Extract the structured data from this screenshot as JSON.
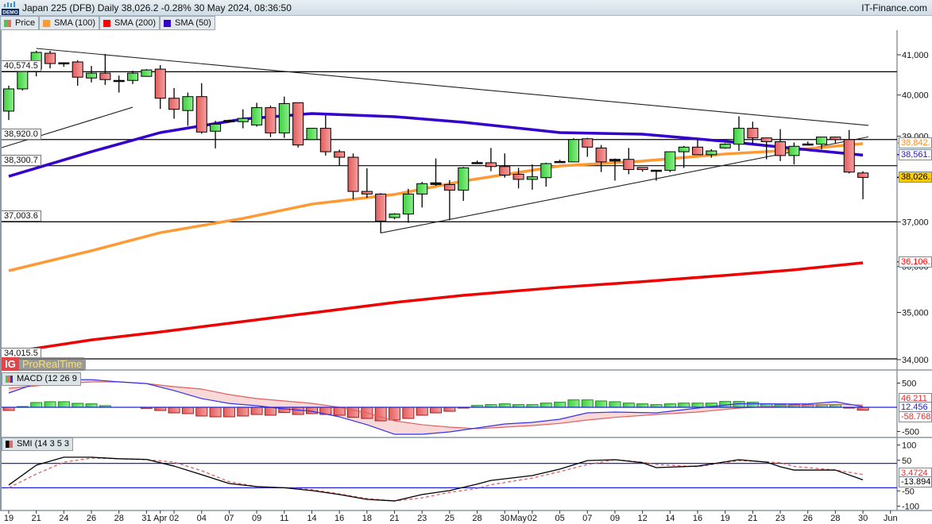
{
  "header": {
    "title": "Japan 225 (DFB) Daily 38,026.2 -0.28% 30 May 2024, 08:36:50",
    "brand": "IT-Finance.com",
    "demo_badge": "DEMO"
  },
  "legend": [
    {
      "label": "Price",
      "colors": [
        "#44cc44",
        "#e86a6a"
      ]
    },
    {
      "label": "SMA (100)",
      "color": "#ff9933"
    },
    {
      "label": "SMA (200)",
      "color": "#ff0000"
    },
    {
      "label": "SMA (50)",
      "color": "#3300cc"
    }
  ],
  "logo": {
    "ig": "IG",
    "text": "ProRealTime"
  },
  "chart_data": {
    "type": "candlestick",
    "title": "Japan 225 (DFB) Daily",
    "price_scale": "log",
    "ylim": [
      34000,
      41500
    ],
    "y_ticks": [
      "41,000",
      "40,000",
      "39,000",
      "37,000",
      "36,000",
      "35,000",
      "34,000"
    ],
    "y_tick_values": [
      41000,
      40000,
      39000,
      37000,
      36000,
      35000,
      34000
    ],
    "x_ticks": [
      {
        "label": "19",
        "i": 0
      },
      {
        "label": "21",
        "i": 2
      },
      {
        "label": "24",
        "i": 4
      },
      {
        "label": "26",
        "i": 6
      },
      {
        "label": "28",
        "i": 8
      },
      {
        "label": "31",
        "i": 10
      },
      {
        "label": "Apr",
        "i": 11
      },
      {
        "label": "02",
        "i": 12
      },
      {
        "label": "04",
        "i": 14
      },
      {
        "label": "07",
        "i": 16
      },
      {
        "label": "09",
        "i": 18
      },
      {
        "label": "11",
        "i": 20
      },
      {
        "label": "14",
        "i": 22
      },
      {
        "label": "16",
        "i": 24
      },
      {
        "label": "18",
        "i": 26
      },
      {
        "label": "21",
        "i": 28
      },
      {
        "label": "23",
        "i": 30
      },
      {
        "label": "25",
        "i": 32
      },
      {
        "label": "28",
        "i": 34
      },
      {
        "label": "30",
        "i": 36
      },
      {
        "label": "May",
        "i": 37
      },
      {
        "label": "02",
        "i": 38
      },
      {
        "label": "05",
        "i": 40
      },
      {
        "label": "07",
        "i": 42
      },
      {
        "label": "09",
        "i": 44
      },
      {
        "label": "12",
        "i": 46
      },
      {
        "label": "14",
        "i": 48
      },
      {
        "label": "16",
        "i": 50
      },
      {
        "label": "19",
        "i": 52
      },
      {
        "label": "21",
        "i": 54
      },
      {
        "label": "23",
        "i": 56
      },
      {
        "label": "26",
        "i": 58
      },
      {
        "label": "28",
        "i": 60
      },
      {
        "label": "30",
        "i": 62
      },
      {
        "label": "Jun",
        "i": 64
      }
    ],
    "candles": [
      [
        39606,
        40230,
        39390,
        40150
      ],
      [
        40150,
        40580,
        40110,
        40580
      ],
      [
        40640,
        41100,
        40460,
        41060
      ],
      [
        41040,
        41100,
        40660,
        40780
      ],
      [
        40800,
        40810,
        40700,
        40790
      ],
      [
        40820,
        40860,
        40230,
        40440
      ],
      [
        40420,
        40720,
        40310,
        40540
      ],
      [
        40540,
        41020,
        40250,
        40380
      ],
      [
        40360,
        40480,
        40060,
        40340
      ],
      [
        40360,
        40600,
        40270,
        40540
      ],
      [
        40460,
        40640,
        40460,
        40620
      ],
      [
        40640,
        40740,
        39660,
        39920
      ],
      [
        39920,
        40170,
        39420,
        39650
      ],
      [
        39620,
        40060,
        39250,
        39960
      ],
      [
        39960,
        40290,
        39060,
        39100
      ],
      [
        39120,
        39370,
        38710,
        39290
      ],
      [
        39350,
        39400,
        39330,
        39380
      ],
      [
        39350,
        39650,
        39190,
        39430
      ],
      [
        39270,
        39810,
        39230,
        39690
      ],
      [
        39690,
        39740,
        38980,
        39080
      ],
      [
        39080,
        39960,
        38960,
        39790
      ],
      [
        39810,
        39810,
        38730,
        38790
      ],
      [
        38920,
        39190,
        38920,
        39190
      ],
      [
        39190,
        39500,
        38540,
        38630
      ],
      [
        38630,
        38680,
        38300,
        38500
      ],
      [
        38500,
        38590,
        37520,
        37700
      ],
      [
        37700,
        38240,
        37550,
        37640
      ],
      [
        37640,
        37660,
        36750,
        37020
      ],
      [
        37100,
        37200,
        37060,
        37180
      ],
      [
        37180,
        37760,
        36980,
        37640
      ],
      [
        37640,
        37920,
        37330,
        37880
      ],
      [
        37900,
        38470,
        37830,
        37860
      ],
      [
        37860,
        37960,
        37040,
        37730
      ],
      [
        37730,
        38270,
        37480,
        38250
      ],
      [
        38370,
        38420,
        38350,
        38375
      ],
      [
        38370,
        38720,
        38170,
        38280
      ],
      [
        38280,
        38590,
        38020,
        38080
      ],
      [
        38100,
        38250,
        37770,
        37980
      ],
      [
        37980,
        38330,
        37740,
        38040
      ],
      [
        38020,
        38370,
        37810,
        38350
      ],
      [
        38390,
        38440,
        38370,
        38400
      ],
      [
        38390,
        38950,
        38390,
        38920
      ],
      [
        38940,
        38960,
        38510,
        38740
      ],
      [
        38720,
        38790,
        38150,
        38390
      ],
      [
        38410,
        38470,
        37950,
        38450
      ],
      [
        38450,
        38720,
        38100,
        38210
      ],
      [
        38260,
        38260,
        38160,
        38210
      ],
      [
        38190,
        38200,
        37950,
        38195
      ],
      [
        38190,
        38630,
        38150,
        38630
      ],
      [
        38630,
        38770,
        38250,
        38740
      ],
      [
        38740,
        38920,
        38560,
        38560
      ],
      [
        38560,
        38690,
        38490,
        38650
      ],
      [
        38720,
        38830,
        38700,
        38810
      ],
      [
        38810,
        39480,
        38650,
        39190
      ],
      [
        39190,
        39350,
        38790,
        38960
      ],
      [
        38960,
        38960,
        38450,
        38870
      ],
      [
        38870,
        39170,
        38410,
        38540
      ],
      [
        38540,
        38850,
        38330,
        38760
      ],
      [
        38810,
        38870,
        38790,
        38815
      ],
      [
        38810,
        38980,
        38690,
        38980
      ],
      [
        38980,
        38990,
        38830,
        38920
      ],
      [
        38920,
        39150,
        38120,
        38150
      ],
      [
        38130,
        38170,
        37520,
        38026
      ]
    ],
    "sma_index": [
      0,
      6,
      11,
      17,
      22,
      28,
      33,
      40,
      46,
      52,
      57,
      62
    ],
    "sma50": [
      38052,
      38631,
      39087,
      39413,
      39547,
      39470,
      39336,
      39087,
      39049,
      38878,
      38708,
      38551
    ],
    "sma100": [
      35908,
      36352,
      36757,
      37081,
      37408,
      37630,
      37941,
      38294,
      38409,
      38577,
      38671,
      38823
    ],
    "sma200": [
      34150,
      34415,
      34583,
      34805,
      34990,
      35215,
      35370,
      35543,
      35667,
      35806,
      35928,
      36083
    ],
    "trendlines": [
      {
        "from": [
          2,
          41160
        ],
        "to": [
          62.4,
          39260
        ]
      },
      {
        "from": [
          -0.6,
          38720
        ],
        "to": [
          9,
          39700
        ]
      },
      {
        "from": [
          27,
          36750
        ],
        "to": [
          62.4,
          38985
        ]
      }
    ],
    "levels": [
      {
        "value": 40574.5,
        "label": "40,574.5"
      },
      {
        "value": 38920.0,
        "label": "38,920.0"
      },
      {
        "value": 38300.7,
        "label": "38,300.7"
      },
      {
        "value": 37003.6,
        "label": "37,003.6"
      },
      {
        "value": 34015.5,
        "label": "34,015.5"
      }
    ],
    "last_values": [
      {
        "label": "38,842..",
        "value": 38842,
        "color": "#ff8c1a",
        "bg": "#ffffff"
      },
      {
        "label": "38,561..",
        "value": 38561,
        "color": "#2a12d0",
        "bg": "#ffffff"
      },
      {
        "label": "38,026..",
        "value": 38026,
        "color": "#000000",
        "bg": "#ffcc00"
      },
      {
        "label": "36,106..",
        "value": 36106,
        "color": "#ff0000",
        "bg": "#ffffff"
      }
    ],
    "macd": {
      "label": "MACD (12 26 9",
      "ticks": [
        {
          "label": "500",
          "v": 500
        },
        {
          "label": "-500",
          "v": -500
        }
      ],
      "hist": [
        -65,
        16,
        98,
        115,
        115,
        82,
        71,
        33,
        0,
        0,
        -22,
        -66,
        -115,
        -131,
        -180,
        -197,
        -197,
        -180,
        -148,
        -164,
        -109,
        -148,
        -131,
        -148,
        -164,
        -208,
        -230,
        -279,
        -262,
        -230,
        -164,
        -115,
        -82,
        -16,
        38,
        55,
        71,
        55,
        55,
        87,
        104,
        153,
        153,
        131,
        115,
        87,
        71,
        55,
        71,
        87,
        87,
        87,
        120,
        120,
        104,
        71,
        55,
        55,
        55,
        55,
        55,
        -16,
        -58.768
      ],
      "line_index": [
        0,
        2,
        4,
        6,
        8,
        10,
        12,
        14,
        16,
        18,
        20,
        22,
        24,
        26,
        28,
        30,
        32,
        34,
        36,
        38,
        40,
        42,
        44,
        47,
        50,
        53,
        56,
        58,
        60,
        62
      ],
      "macd_line": [
        295,
        490,
        570,
        570,
        525,
        490,
        345,
        180,
        80,
        33,
        -33,
        -82,
        -197,
        -360,
        -557,
        -557,
        -508,
        -426,
        -344,
        -311,
        -246,
        -115,
        -98,
        -115,
        -16,
        76,
        71,
        71,
        115,
        12.456
      ],
      "signal_line": [
        393,
        443,
        490,
        525,
        525,
        490,
        426,
        377,
        262,
        180,
        131,
        82,
        0,
        -115,
        -279,
        -360,
        -410,
        -443,
        -410,
        -377,
        -333,
        -262,
        -208,
        -148,
        -98,
        -16,
        27,
        44,
        55,
        46.211
      ],
      "value_labels": [
        {
          "label": "46.211",
          "color": "#e03030"
        },
        {
          "label": "12.456",
          "color": "#2222dd"
        },
        {
          "label": "-58.768",
          "color": "#e03030"
        }
      ]
    },
    "smi": {
      "label": "SMI (14 3 5 3",
      "ticks": [
        {
          "label": "100",
          "v": 100
        },
        {
          "label": "50",
          "v": 50
        },
        {
          "label": "-50",
          "v": -50
        },
        {
          "label": "-100",
          "v": -100
        }
      ],
      "bands": [
        40,
        -40
      ],
      "line_index": [
        0,
        2,
        4,
        6,
        8,
        10,
        12,
        14,
        16,
        18,
        20,
        22,
        24,
        26,
        28,
        30,
        32,
        34,
        35,
        38,
        40,
        42,
        44,
        46,
        47,
        50,
        53,
        55,
        56,
        57,
        60,
        62
      ],
      "smi_line": [
        -31,
        34,
        60,
        60,
        55,
        53,
        31,
        3,
        -26,
        -36,
        -40,
        -49,
        -62,
        -78,
        -83,
        -62,
        -49,
        -28,
        -16,
        0,
        21,
        49,
        52,
        42,
        26,
        31,
        52,
        44,
        29,
        18,
        18,
        -13.894
      ],
      "signal_line": [
        -40,
        5,
        44,
        57,
        55,
        52,
        44,
        16,
        -20,
        -36,
        -40,
        -46,
        -60,
        -75,
        -83,
        -73,
        -55,
        -42,
        -30,
        -8,
        13,
        36,
        52,
        44,
        36,
        29,
        49,
        45,
        42,
        30,
        18,
        3.4724
      ],
      "value_labels": [
        {
          "label": "3.4724",
          "color": "#e03030"
        },
        {
          "label": "-13.894",
          "color": "#000000"
        }
      ]
    }
  }
}
